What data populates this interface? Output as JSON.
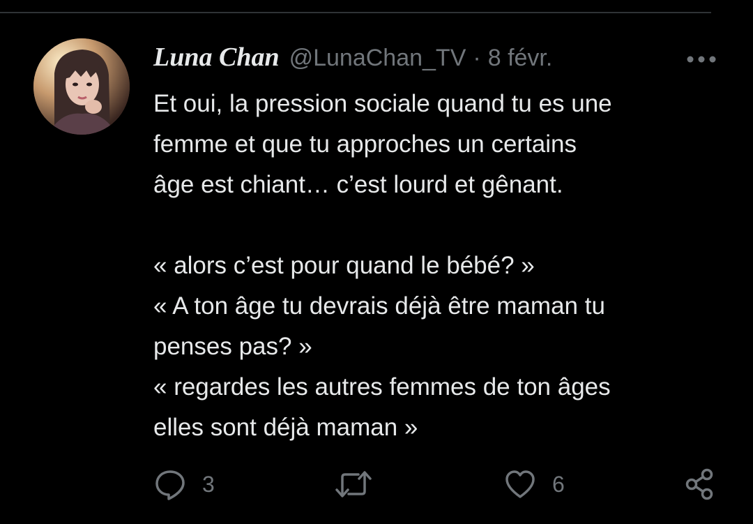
{
  "tweet": {
    "author": {
      "display_name": "Luna Chan",
      "handle": "@LunaChan_TV"
    },
    "separator": "·",
    "date": "8 févr.",
    "text_lines": [
      "Et oui, la pression sociale quand tu es une",
      "femme et que tu approches un certains",
      "âge est chiant… c’est lourd et gênant.",
      "",
      "« alors c’est pour quand le bébé? »",
      "« A ton âge tu devrais déjà être maman tu",
      "penses pas? »",
      "« regardes les autres femmes de ton âges",
      "elles sont déjà maman »"
    ],
    "actions": {
      "reply_count": "3",
      "retweet_count": "",
      "like_count": "6"
    }
  },
  "icons": {
    "more": "more-horizontal-icon",
    "reply": "speech-bubble-icon",
    "retweet": "retweet-arrows-icon",
    "like": "heart-outline-icon",
    "share": "share-nodes-icon"
  },
  "colors": {
    "background": "#000000",
    "text_primary": "#e7e9ea",
    "text_secondary": "#71767b",
    "divider": "#2f3336"
  }
}
